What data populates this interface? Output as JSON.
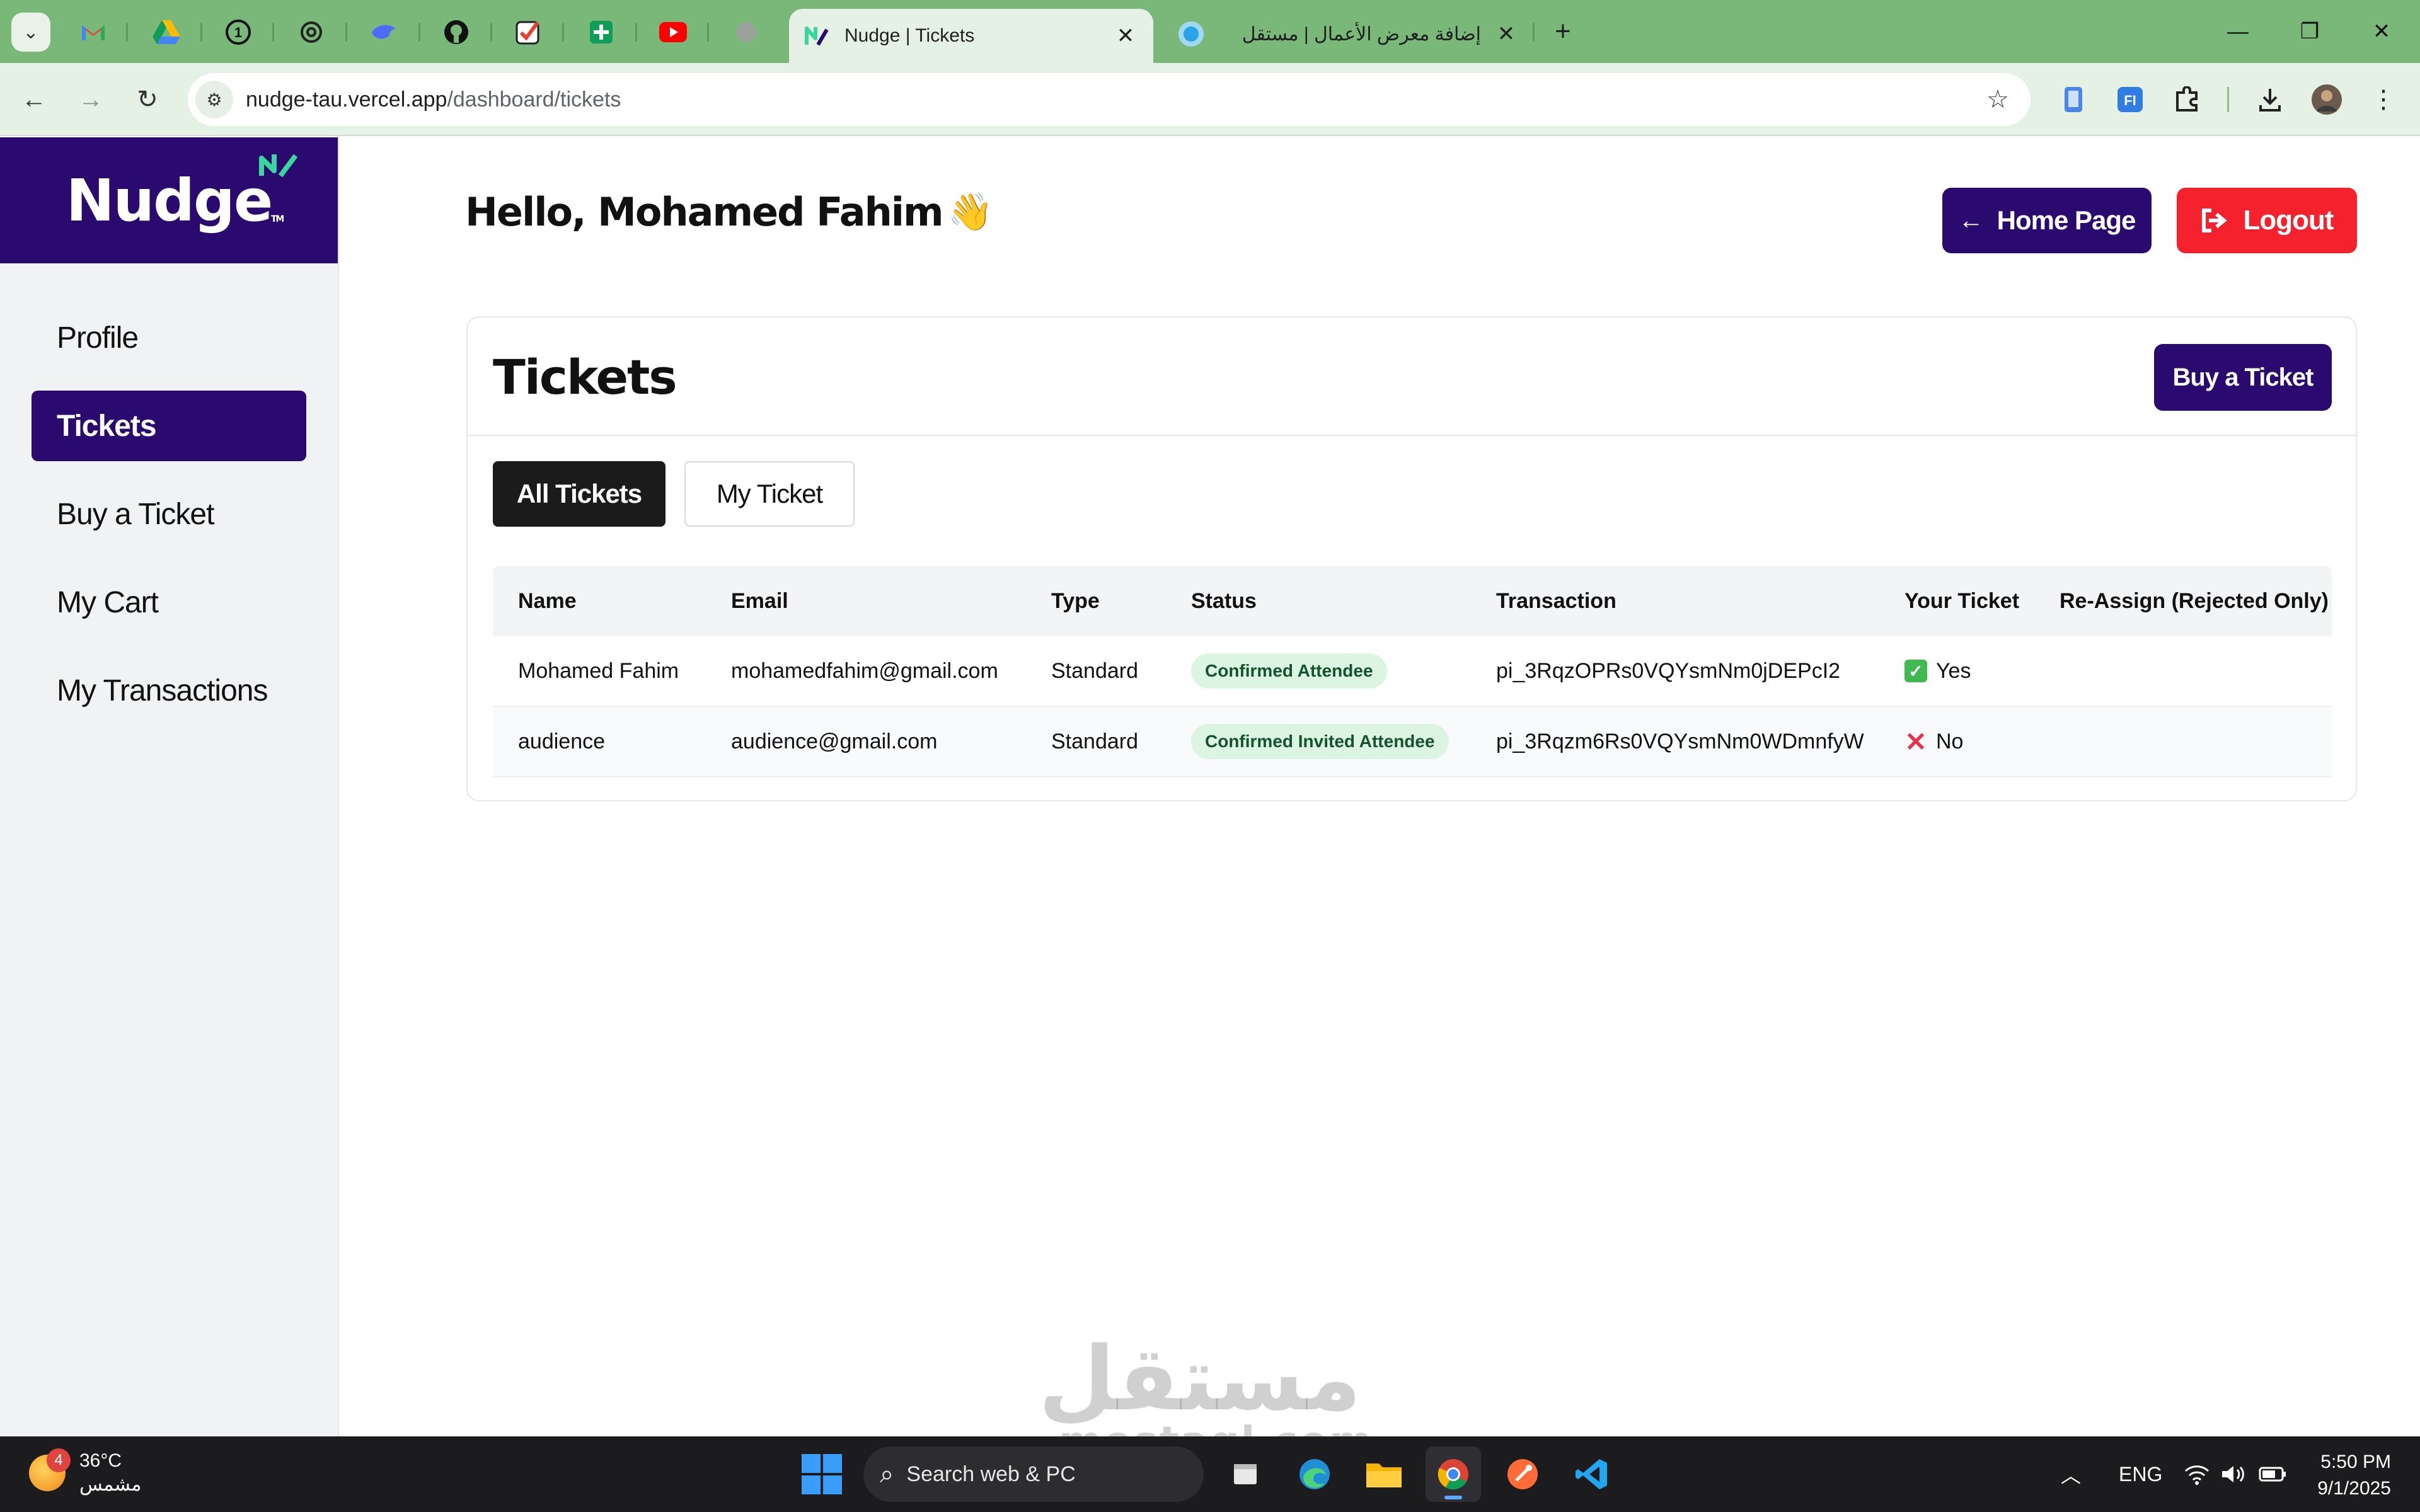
{
  "browser": {
    "pinned_tabs": [
      {
        "icon": "gmail-icon",
        "color": "#ea4335"
      },
      {
        "icon": "google-drive-icon",
        "color": "#fbbc04"
      },
      {
        "icon": "whatsapp-icon",
        "color": "#25d366"
      },
      {
        "icon": "chatgpt-icon",
        "color": "#222222"
      },
      {
        "icon": "deepseek-icon",
        "color": "#4d6bfe"
      },
      {
        "icon": "github-icon",
        "color": "#111111"
      },
      {
        "icon": "todoist-icon",
        "color": "#e44332"
      },
      {
        "icon": "google-sheets-icon",
        "color": "#0f9d58"
      },
      {
        "icon": "youtube-icon",
        "color": "#ff0000"
      },
      {
        "icon": "grey-site-icon",
        "color": "#9aa39a"
      }
    ],
    "active_tab": {
      "title": "Nudge | Tickets",
      "icon": "nudge-favicon-icon"
    },
    "second_tab": {
      "title": "إضافة معرض الأعمال | مستقل",
      "icon": "mostaql-favicon-icon"
    },
    "url": {
      "host": "nudge-tau.vercel.app",
      "path": "/dashboard/tickets"
    }
  },
  "sidebar": {
    "brand": "Nudge",
    "brand_tm": "TM",
    "items": [
      {
        "label": "Profile",
        "active": false
      },
      {
        "label": "Tickets",
        "active": true
      },
      {
        "label": "Buy a Ticket",
        "active": false
      },
      {
        "label": "My Cart",
        "active": false
      },
      {
        "label": "My Transactions",
        "active": false
      }
    ]
  },
  "header": {
    "greeting": "Hello, Mohamed Fahim",
    "wave": "👋",
    "home_button": "Home Page",
    "logout_button": "Logout"
  },
  "tickets": {
    "title": "Tickets",
    "buy_button": "Buy a Ticket",
    "filters": [
      {
        "label": "All Tickets",
        "active": true
      },
      {
        "label": "My Ticket",
        "active": false
      }
    ],
    "columns": [
      "Name",
      "Email",
      "Type",
      "Status",
      "Transaction",
      "Your Ticket",
      "Re-Assign (Rejected Only)"
    ],
    "rows": [
      {
        "name": "Mohamed Fahim",
        "email": "mohamedfahim@gmail.com",
        "type": "Standard",
        "status": "Confirmed Attendee",
        "transaction": "pi_3RqzOPRs0VQYsmNm0jDEPcI2",
        "your_ticket": "Yes",
        "reassign": ""
      },
      {
        "name": "audience",
        "email": "audience@gmail.com",
        "type": "Standard",
        "status": "Confirmed Invited Attendee",
        "transaction": "pi_3Rqzm6Rs0VQYsmNm0WDmnfyW",
        "your_ticket": "No",
        "reassign": ""
      }
    ]
  },
  "watermark": {
    "arabic": "مستقل",
    "latin": "mostaql.com"
  },
  "taskbar": {
    "weather_temp": "36°C",
    "weather_desc": "مشمس",
    "weather_badge": "4",
    "search_placeholder": "Search web & PC",
    "language": "ENG",
    "time": "5:50 PM",
    "date": "9/1/2025"
  },
  "colors": {
    "brand_purple": "#2a0a6e",
    "logout_red": "#f5222d",
    "status_badge_bg": "#dcf5e3",
    "chrome_green": "#7ab87a"
  }
}
